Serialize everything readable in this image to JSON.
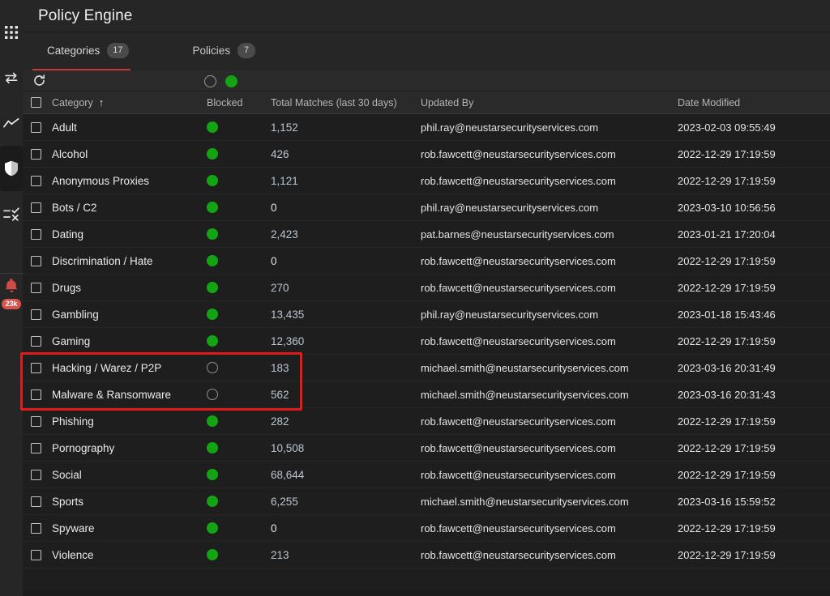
{
  "rail": {
    "items": [
      {
        "name": "apps-grid-icon",
        "label": "Apps"
      },
      {
        "name": "transfer-icon",
        "label": "Traffic"
      },
      {
        "name": "analytics-icon",
        "label": "Analytics"
      },
      {
        "name": "shield-icon",
        "label": "Security"
      },
      {
        "name": "checklist-icon",
        "label": "Policies"
      }
    ],
    "notification": {
      "icon": "bell-icon",
      "badge": "23k"
    }
  },
  "header": {
    "title": "Policy Engine"
  },
  "tabs": [
    {
      "label": "Categories",
      "count": "17",
      "active": true
    },
    {
      "label": "Policies",
      "count": "7",
      "active": false
    }
  ],
  "toolbar": {
    "refresh_label": "Refresh",
    "toggle_unblocked": "off",
    "toggle_blocked": "on"
  },
  "table": {
    "columns": [
      {
        "key": "category",
        "label": "Category",
        "sort": "asc",
        "sort_glyph": "↑"
      },
      {
        "key": "blocked",
        "label": "Blocked"
      },
      {
        "key": "matches",
        "label": "Total Matches (last 30 days)"
      },
      {
        "key": "updated_by",
        "label": "Updated By"
      },
      {
        "key": "date_modified",
        "label": "Date Modified"
      }
    ],
    "rows": [
      {
        "category": "Adult",
        "blocked": true,
        "matches": "1,152",
        "updated_by": "phil.ray@neustarsecurityservices.com",
        "date_modified": "2023-02-03 09:55:49",
        "highlighted": false
      },
      {
        "category": "Alcohol",
        "blocked": true,
        "matches": "426",
        "updated_by": "rob.fawcett@neustarsecurityservices.com",
        "date_modified": "2022-12-29 17:19:59",
        "highlighted": false
      },
      {
        "category": "Anonymous Proxies",
        "blocked": true,
        "matches": "1,121",
        "updated_by": "rob.fawcett@neustarsecurityservices.com",
        "date_modified": "2022-12-29 17:19:59",
        "highlighted": false
      },
      {
        "category": "Bots / C2",
        "blocked": true,
        "matches": "0",
        "updated_by": "phil.ray@neustarsecurityservices.com",
        "date_modified": "2023-03-10 10:56:56",
        "highlighted": false
      },
      {
        "category": "Dating",
        "blocked": true,
        "matches": "2,423",
        "updated_by": "pat.barnes@neustarsecurityservices.com",
        "date_modified": "2023-01-21 17:20:04",
        "highlighted": false
      },
      {
        "category": "Discrimination / Hate",
        "blocked": true,
        "matches": "0",
        "updated_by": "rob.fawcett@neustarsecurityservices.com",
        "date_modified": "2022-12-29 17:19:59",
        "highlighted": false
      },
      {
        "category": "Drugs",
        "blocked": true,
        "matches": "270",
        "updated_by": "rob.fawcett@neustarsecurityservices.com",
        "date_modified": "2022-12-29 17:19:59",
        "highlighted": false
      },
      {
        "category": "Gambling",
        "blocked": true,
        "matches": "13,435",
        "updated_by": "phil.ray@neustarsecurityservices.com",
        "date_modified": "2023-01-18 15:43:46",
        "highlighted": false
      },
      {
        "category": "Gaming",
        "blocked": true,
        "matches": "12,360",
        "updated_by": "rob.fawcett@neustarsecurityservices.com",
        "date_modified": "2022-12-29 17:19:59",
        "highlighted": false
      },
      {
        "category": "Hacking / Warez / P2P",
        "blocked": false,
        "matches": "183",
        "updated_by": "michael.smith@neustarsecurityservices.com",
        "date_modified": "2023-03-16 20:31:49",
        "highlighted": true
      },
      {
        "category": "Malware & Ransomware",
        "blocked": false,
        "matches": "562",
        "updated_by": "michael.smith@neustarsecurityservices.com",
        "date_modified": "2023-03-16 20:31:43",
        "highlighted": true
      },
      {
        "category": "Phishing",
        "blocked": true,
        "matches": "282",
        "updated_by": "rob.fawcett@neustarsecurityservices.com",
        "date_modified": "2022-12-29 17:19:59",
        "highlighted": false
      },
      {
        "category": "Pornography",
        "blocked": true,
        "matches": "10,508",
        "updated_by": "rob.fawcett@neustarsecurityservices.com",
        "date_modified": "2022-12-29 17:19:59",
        "highlighted": false
      },
      {
        "category": "Social",
        "blocked": true,
        "matches": "68,644",
        "updated_by": "rob.fawcett@neustarsecurityservices.com",
        "date_modified": "2022-12-29 17:19:59",
        "highlighted": false
      },
      {
        "category": "Sports",
        "blocked": true,
        "matches": "6,255",
        "updated_by": "michael.smith@neustarsecurityservices.com",
        "date_modified": "2023-03-16 15:59:52",
        "highlighted": false
      },
      {
        "category": "Spyware",
        "blocked": true,
        "matches": "0",
        "updated_by": "rob.fawcett@neustarsecurityservices.com",
        "date_modified": "2022-12-29 17:19:59",
        "highlighted": false
      },
      {
        "category": "Violence",
        "blocked": true,
        "matches": "213",
        "updated_by": "rob.fawcett@neustarsecurityservices.com",
        "date_modified": "2022-12-29 17:19:59",
        "highlighted": false
      }
    ]
  },
  "colors": {
    "accent_red": "#c43c36",
    "annotation_red": "#e01b1b",
    "blocked_green": "#13a413",
    "link_blue": "#b9c6d1",
    "badge_red": "#d9534f"
  }
}
